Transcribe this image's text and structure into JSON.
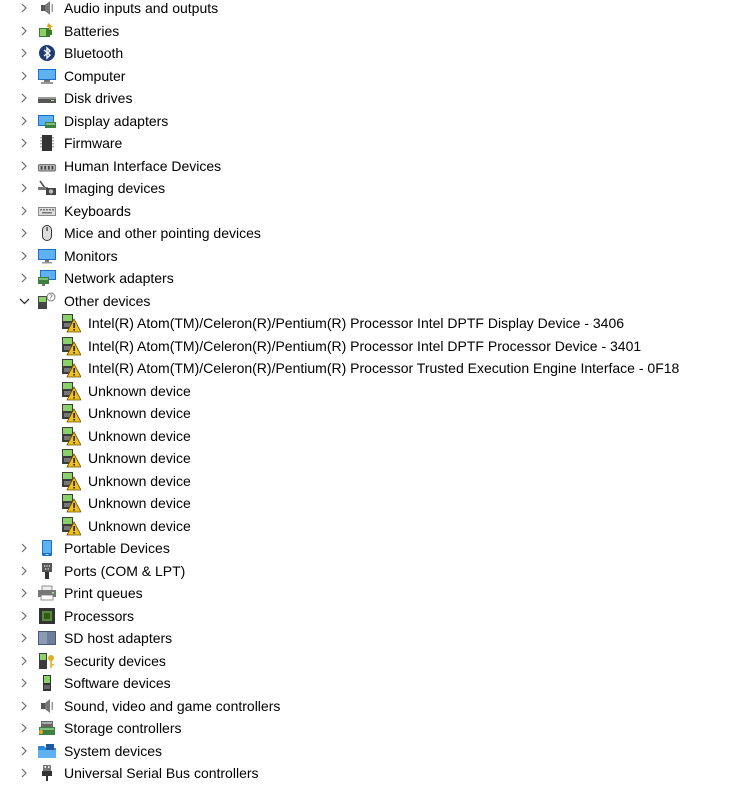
{
  "device_tree": {
    "categories_before": [
      {
        "label": "Audio inputs and outputs",
        "icon": "speaker-icon"
      },
      {
        "label": "Batteries",
        "icon": "battery-icon"
      },
      {
        "label": "Bluetooth",
        "icon": "bluetooth-icon"
      },
      {
        "label": "Computer",
        "icon": "computer-icon"
      },
      {
        "label": "Disk drives",
        "icon": "disk-drive-icon"
      },
      {
        "label": "Display adapters",
        "icon": "display-adapter-icon"
      },
      {
        "label": "Firmware",
        "icon": "firmware-icon"
      },
      {
        "label": "Human Interface Devices",
        "icon": "hid-icon"
      },
      {
        "label": "Imaging devices",
        "icon": "camera-icon"
      },
      {
        "label": "Keyboards",
        "icon": "keyboard-icon"
      },
      {
        "label": "Mice and other pointing devices",
        "icon": "mouse-icon"
      },
      {
        "label": "Monitors",
        "icon": "monitor-icon"
      },
      {
        "label": "Network adapters",
        "icon": "network-adapter-icon"
      }
    ],
    "expanded_category": {
      "label": "Other devices",
      "icon": "other-devices-icon",
      "children": [
        {
          "label": "Intel(R) Atom(TM)/Celeron(R)/Pentium(R) Processor Intel DPTF Display Device - 3406",
          "icon": "warning-device-icon"
        },
        {
          "label": "Intel(R) Atom(TM)/Celeron(R)/Pentium(R) Processor Intel DPTF Processor Device - 3401",
          "icon": "warning-device-icon"
        },
        {
          "label": "Intel(R) Atom(TM)/Celeron(R)/Pentium(R) Processor Trusted Execution Engine Interface - 0F18",
          "icon": "warning-device-icon"
        },
        {
          "label": "Unknown device",
          "icon": "warning-device-icon"
        },
        {
          "label": "Unknown device",
          "icon": "warning-device-icon"
        },
        {
          "label": "Unknown device",
          "icon": "warning-device-icon"
        },
        {
          "label": "Unknown device",
          "icon": "warning-device-icon"
        },
        {
          "label": "Unknown device",
          "icon": "warning-device-icon"
        },
        {
          "label": "Unknown device",
          "icon": "warning-device-icon"
        },
        {
          "label": "Unknown device",
          "icon": "warning-device-icon"
        }
      ]
    },
    "categories_after": [
      {
        "label": "Portable Devices",
        "icon": "portable-device-icon"
      },
      {
        "label": "Ports (COM & LPT)",
        "icon": "port-icon"
      },
      {
        "label": "Print queues",
        "icon": "printer-icon"
      },
      {
        "label": "Processors",
        "icon": "processor-icon"
      },
      {
        "label": "SD host adapters",
        "icon": "sd-card-icon"
      },
      {
        "label": "Security devices",
        "icon": "security-device-icon"
      },
      {
        "label": "Software devices",
        "icon": "software-device-icon"
      },
      {
        "label": "Sound, video and game controllers",
        "icon": "speaker-icon"
      },
      {
        "label": "Storage controllers",
        "icon": "storage-controller-icon"
      },
      {
        "label": "System devices",
        "icon": "system-folder-icon"
      },
      {
        "label": "Universal Serial Bus controllers",
        "icon": "usb-icon"
      }
    ]
  }
}
